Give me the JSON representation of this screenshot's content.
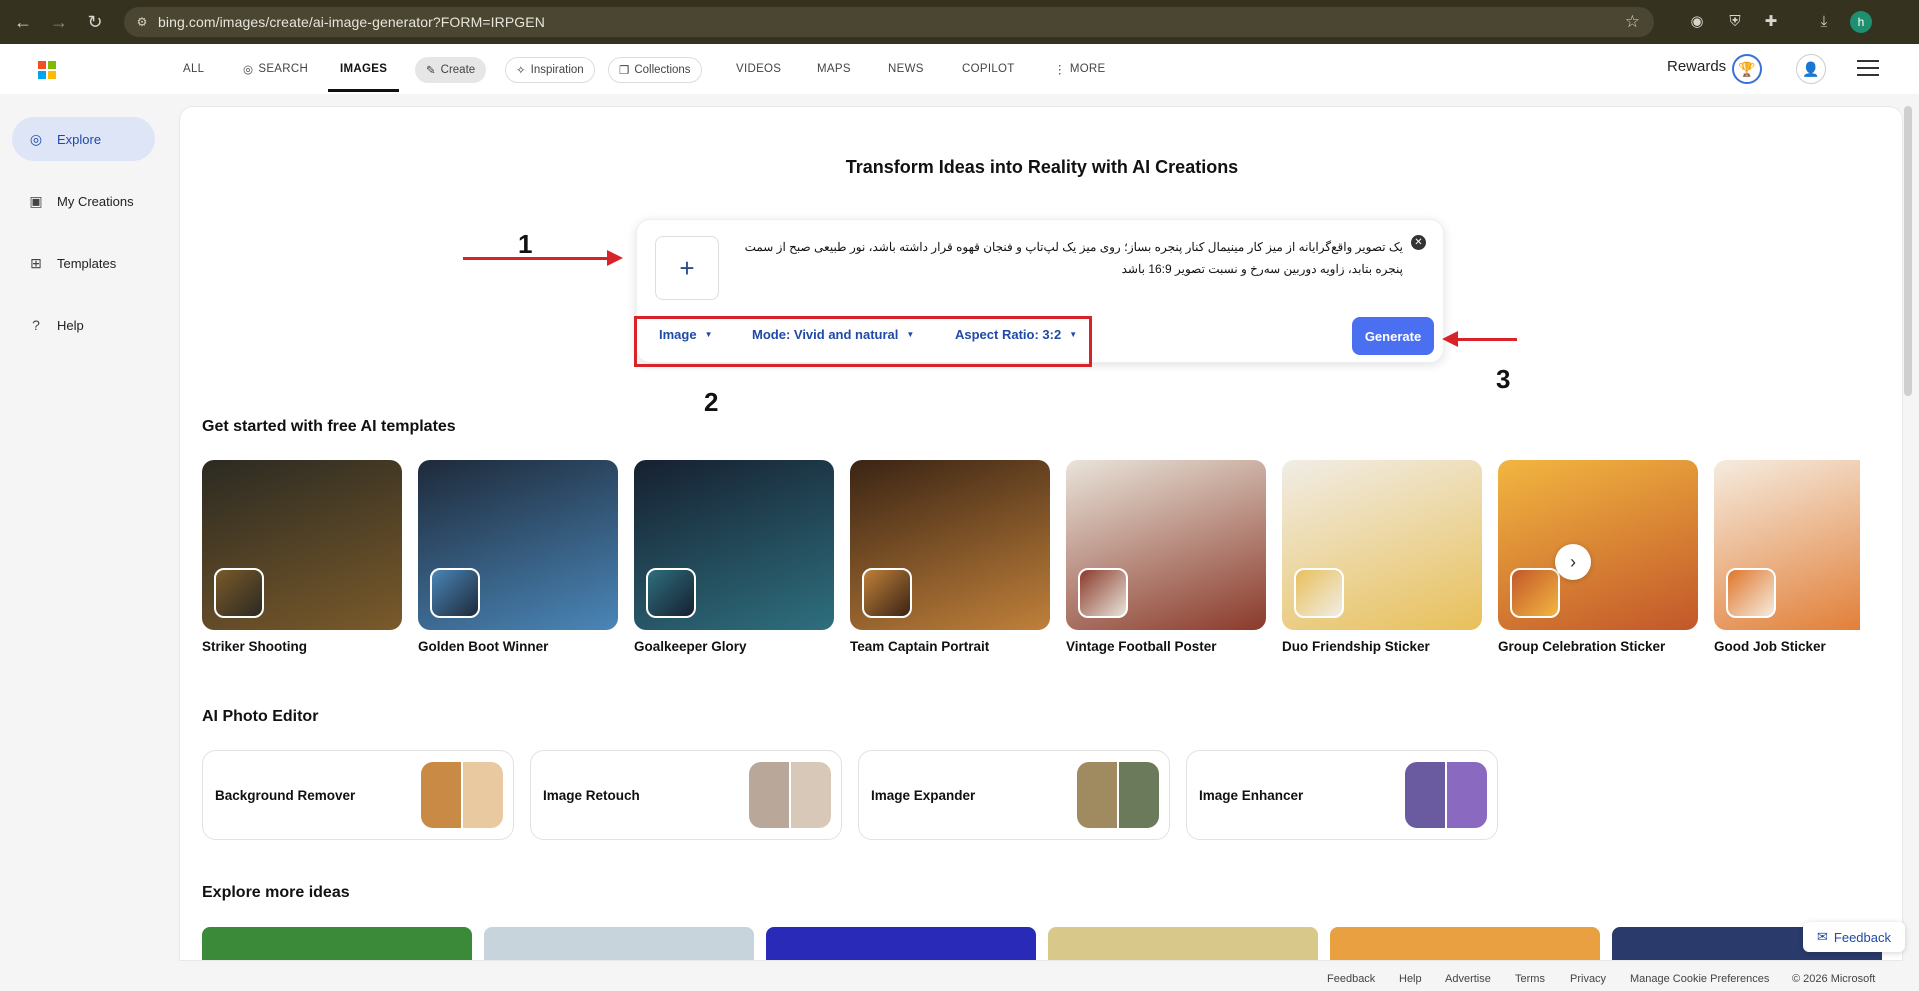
{
  "browser": {
    "url": "bing.com/images/create/ai-image-generator?FORM=IRPGEN",
    "profile_initial": "h"
  },
  "topnav": {
    "tabs": [
      {
        "label": "ALL"
      },
      {
        "label": "SEARCH"
      },
      {
        "label": "IMAGES"
      },
      {
        "label": "Create"
      },
      {
        "label": "Inspiration"
      },
      {
        "label": "Collections"
      },
      {
        "label": "VIDEOS"
      },
      {
        "label": "MAPS"
      },
      {
        "label": "NEWS"
      },
      {
        "label": "COPILOT"
      },
      {
        "label": "MORE"
      }
    ],
    "rewards_label": "Rewards"
  },
  "sidebar": {
    "items": [
      {
        "label": "Explore",
        "icon": "compass-icon"
      },
      {
        "label": "My Creations",
        "icon": "creations-icon"
      },
      {
        "label": "Templates",
        "icon": "templates-icon"
      },
      {
        "label": "Help",
        "icon": "help-icon"
      }
    ]
  },
  "hero": {
    "title": "Transform Ideas into Reality with AI Creations",
    "prompt_text": "یک تصویر واقع‌گرایانه از میز کار مینیمال کنار پنجره بساز؛ روی میز یک لپ‌تاپ و فنجان قهوه قرار داشته باشد، نور طبیعی صبح از سمت پنجره بتابد، زاویه دوربین سه‌رخ و نسبت تصویر 16:9 باشد",
    "options": [
      "Image",
      "Mode: Vivid and natural",
      "Aspect Ratio: 3:2"
    ],
    "generate_label": "Generate"
  },
  "annotations": {
    "one": "1",
    "two": "2",
    "three": "3"
  },
  "templates": {
    "title": "Get started with free AI templates",
    "items": [
      {
        "label": "Striker Shooting",
        "colors": [
          "#2b2a22",
          "#7a5a2a"
        ]
      },
      {
        "label": "Golden Boot Winner",
        "colors": [
          "#1e2a3a",
          "#4a86b8"
        ]
      },
      {
        "label": "Goalkeeper Glory",
        "colors": [
          "#162030",
          "#2e6f7e"
        ]
      },
      {
        "label": "Team Captain Portrait",
        "colors": [
          "#3a2414",
          "#c0803a"
        ]
      },
      {
        "label": "Vintage Football Poster",
        "colors": [
          "#e9e4da",
          "#8a3a2a"
        ]
      },
      {
        "label": "Duo Friendship Sticker",
        "colors": [
          "#f1ede6",
          "#e8c05a"
        ]
      },
      {
        "label": "Group Celebration Sticker",
        "colors": [
          "#f2b640",
          "#c2572a"
        ]
      },
      {
        "label": "Good Job Sticker",
        "colors": [
          "#f5ece0",
          "#e0762a"
        ]
      }
    ]
  },
  "editor": {
    "title": "AI Photo Editor",
    "items": [
      {
        "label": "Background Remover",
        "colors": [
          "#c98a45",
          "#e8c9a0"
        ]
      },
      {
        "label": "Image Retouch",
        "colors": [
          "#b9a89a",
          "#d8c8b8"
        ]
      },
      {
        "label": "Image Expander",
        "colors": [
          "#a08a60",
          "#6b7a5a"
        ]
      },
      {
        "label": "Image Enhancer",
        "colors": [
          "#6a5aa0",
          "#8a6ac0"
        ]
      }
    ]
  },
  "explore": {
    "title": "Explore more ideas",
    "colors": [
      "#3a8a3a",
      "#c8d4dc",
      "#2a2ab8",
      "#d8c88a",
      "#e8a040",
      "#2a3a6a"
    ]
  },
  "feedback_label": "Feedback",
  "footer": {
    "links": [
      "Feedback",
      "Help",
      "Advertise",
      "Terms",
      "Privacy",
      "Manage Cookie Preferences",
      "© 2026 Microsoft"
    ]
  },
  "colors": {
    "accent": "#4a6ff0",
    "link_blue": "#1f4aa8",
    "annotation_red": "#d9232b"
  }
}
